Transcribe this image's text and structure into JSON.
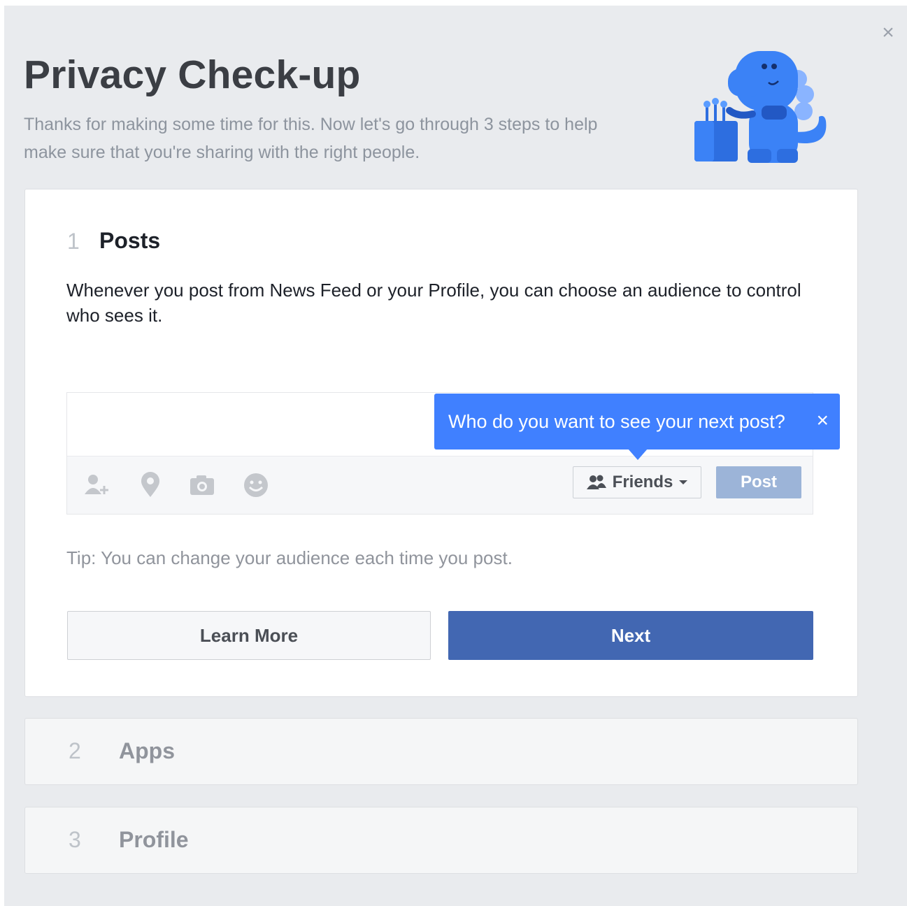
{
  "dialog": {
    "title": "Privacy Check-up",
    "subtitle": "Thanks for making some time for this. Now let's go through 3 steps to help make sure that you're sharing with the right people.",
    "close_icon": "close-icon"
  },
  "steps": [
    {
      "number": "1",
      "title": "Posts",
      "description": "Whenever you post from News Feed or your Profile, you can choose an audience to control who sees it.",
      "tooltip": "Who do you want to see your next post?",
      "audience_label": "Friends",
      "post_label": "Post",
      "tip": "Tip: You can change your audience each time you post.",
      "learn_more_label": "Learn More",
      "next_label": "Next"
    },
    {
      "number": "2",
      "title": "Apps"
    },
    {
      "number": "3",
      "title": "Profile"
    }
  ],
  "colors": {
    "accent": "#4267b2",
    "tooltip": "#4080ff",
    "background": "#e9ebee"
  },
  "icons": [
    "tag-friends-icon",
    "location-pin-icon",
    "camera-icon",
    "feeling-emoji-icon",
    "friends-icon",
    "dropdown-caret-icon",
    "mascot-dinosaur-illustration"
  ]
}
